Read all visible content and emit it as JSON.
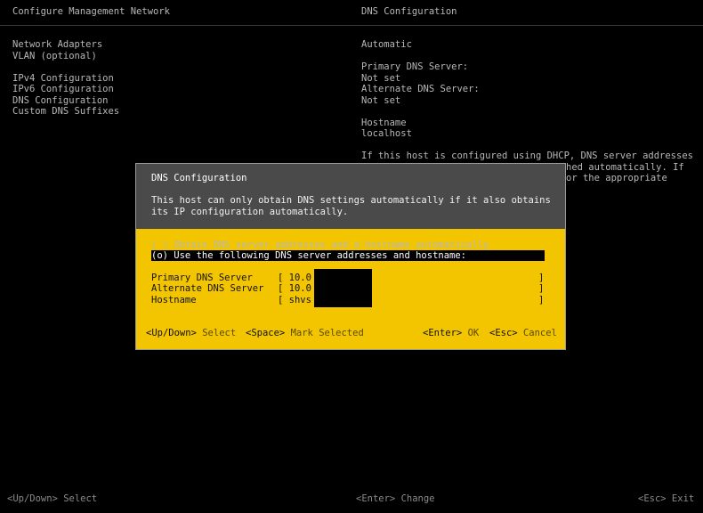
{
  "header": {
    "left_title": "Configure Management Network",
    "right_title": "DNS Configuration"
  },
  "menu": {
    "items": [
      "Network Adapters",
      "VLAN (optional)",
      "",
      "IPv4 Configuration",
      "IPv6 Configuration",
      "DNS Configuration",
      "Custom DNS Suffixes"
    ]
  },
  "right_panel": {
    "mode": "Automatic",
    "primary_label": "Primary DNS Server:",
    "primary_value": "Not set",
    "alternate_label": "Alternate DNS Server:",
    "alternate_value": "Not set",
    "hostname_label": "Hostname",
    "hostname_value": "localhost",
    "info_line1": "If this host is configured using DHCP, DNS server addresses",
    "info_line2": "hed automatically. If",
    "info_line3": "or the appropriate"
  },
  "dialog": {
    "title": "DNS Configuration",
    "message_line1": "This host can only obtain DNS settings automatically if it also obtains",
    "message_line2": "its IP configuration automatically.",
    "option_auto": "( ) Obtain DNS server addresses and a hostname automatically",
    "option_manual": "(o) Use the following DNS server addresses and hostname:",
    "fields": {
      "primary_label": "Primary DNS Server",
      "primary_value": "[ 10.0",
      "alternate_label": "Alternate DNS Server",
      "alternate_value": "[ 10.0",
      "hostname_label": "Hostname",
      "hostname_value": "[ shvs",
      "close_bracket": "]"
    },
    "keys": {
      "updown_key": "<Up/Down>",
      "updown_action": "Select",
      "space_key": "<Space>",
      "space_action": "Mark Selected",
      "enter_key": "<Enter>",
      "enter_action": "OK",
      "esc_key": "<Esc>",
      "esc_action": "Cancel"
    }
  },
  "footer": {
    "left": "<Up/Down> Select",
    "center": "<Enter> Change",
    "right": "<Esc> Exit"
  },
  "colors": {
    "background": "#000000",
    "dialog_yellow": "#f2c500",
    "dialog_header": "#4a4a4a",
    "text": "#b8b8b8"
  }
}
